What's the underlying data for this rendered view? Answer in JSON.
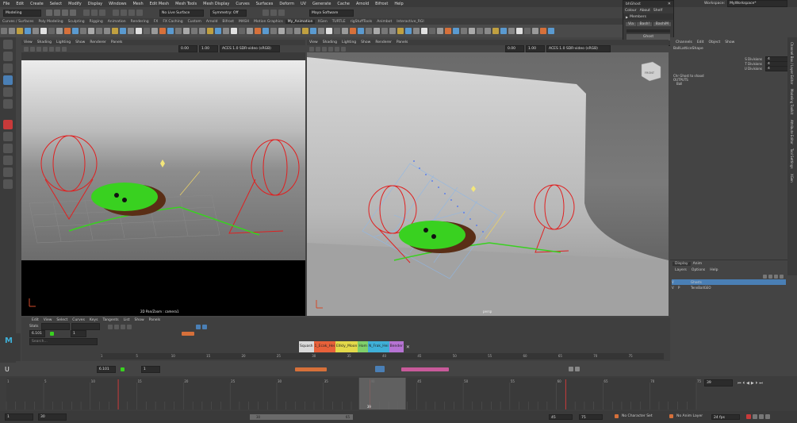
{
  "menubar": {
    "items": [
      "File",
      "Edit",
      "Create",
      "Select",
      "Modify",
      "Display",
      "Windows",
      "Mesh",
      "Edit Mesh",
      "Mesh Tools",
      "Mesh Display",
      "Curves",
      "Surfaces",
      "Deform",
      "UV",
      "Generate",
      "Cache",
      "Arnold",
      "Bifrost",
      "Help"
    ],
    "workspace_label": "Workspace:",
    "workspace_value": "MyWorkspace*"
  },
  "statusline": {
    "mode": "Modeling",
    "live_surface": "No Live Surface",
    "symmetry": "Symmetry: Off",
    "renderer": "Maya Software"
  },
  "shelf": {
    "tabs": [
      "Curves / Surfaces",
      "Poly Modeling",
      "Sculpting",
      "Rigging",
      "Animation",
      "Rendering",
      "FX",
      "FX Caching",
      "Custom",
      "Arnold",
      "Bifrost",
      "MASH",
      "Motion Graphics",
      "My_Animation",
      "XGen",
      "TURTLE",
      "rigStuffTools",
      "Animbot",
      "Interactive_RGI"
    ],
    "active": "My_Animation"
  },
  "popup": {
    "title": "bhGhost",
    "menu": [
      "Colour",
      "About",
      "Shelf"
    ],
    "section": "Members",
    "buttons": [
      "Via",
      "Bash!",
      "BashiM"
    ],
    "ghost_label": "Ghost"
  },
  "viewport_left": {
    "menu": [
      "View",
      "Shading",
      "Lighting",
      "Show",
      "Renderer",
      "Panels"
    ],
    "near": "0.00",
    "far": "1.00",
    "colorspace": "ACES 1.0 SDR-video (sRGB)",
    "camera_label": "2D Pan/Zoom : camera1"
  },
  "viewport_right": {
    "menu": [
      "View",
      "Shading",
      "Lighting",
      "Show",
      "Renderer",
      "Panels"
    ],
    "near": "0.00",
    "far": "1.00",
    "colorspace": "ACES 1.0 SDR-video (sRGB)",
    "camera_label": "persp",
    "viewcube_label": "FRONT"
  },
  "channelbox": {
    "tabs": [
      "Channels",
      "Edit",
      "Object",
      "Show"
    ],
    "object_name": "BallLatticeShape",
    "attributes": [
      {
        "name": "S Divisions",
        "value": "4"
      },
      {
        "name": "T Divisions",
        "value": "4"
      },
      {
        "name": "U Divisions",
        "value": "4"
      }
    ],
    "shapes_label": "Chr Ghost to shaod",
    "outputs_label": "OUTPUTS",
    "output_item": "Ball",
    "side_tabs": [
      "Channel Box / Layer Editor",
      "Modeling Toolkit",
      "Attribute Editor",
      "Tool Settings",
      "XGen"
    ]
  },
  "layers": {
    "tabs": [
      "Display",
      "Anim"
    ],
    "menu": [
      "Layers",
      "Options",
      "Help"
    ],
    "items": [
      {
        "v": "V",
        "p": "",
        "name": "Ghosts",
        "selected": true
      },
      {
        "v": "V",
        "p": "P",
        "name": "TennBallGEO",
        "selected": false
      }
    ]
  },
  "grapheditor": {
    "menu": [
      "Edit",
      "View",
      "Select",
      "Curves",
      "Keys",
      "Tangents",
      "List",
      "Show",
      "Panels"
    ],
    "stats_label": "Stats",
    "value1": "6.101",
    "value2": "1",
    "search_placeholder": "Search...",
    "ruler": [
      "1",
      "5",
      "10",
      "15",
      "20",
      "25",
      "30",
      "35",
      "40",
      "45",
      "50",
      "55",
      "60",
      "65",
      "70",
      "75"
    ]
  },
  "chips": [
    {
      "label": "Squash",
      "color": "#d9d9d9"
    },
    {
      "label": "1_Ecak_Hei",
      "color": "#e8613a"
    },
    {
      "label": "Ellkly_Moon",
      "color": "#e3d84a"
    },
    {
      "label": "Hom",
      "color": "#7fcf6a"
    },
    {
      "label": "N_Frak_Hei",
      "color": "#3fb0d8"
    },
    {
      "label": "Bender",
      "color": "#b673d3"
    }
  ],
  "anim_toolbar": {
    "value1": "6.101",
    "value2": "1"
  },
  "timeslider": {
    "ticks": [
      "1",
      "5",
      "10",
      "15",
      "20",
      "25",
      "30",
      "35",
      "40",
      "45",
      "50",
      "55",
      "60",
      "65",
      "70",
      "75"
    ],
    "current_frame": "39",
    "current_field": "39"
  },
  "rangebar": {
    "start": "1",
    "start_inner": "30",
    "range_start_label": "30",
    "range_end_label": "65",
    "end_inner": "45",
    "end": "75",
    "character": "No Character Set",
    "anim_layer": "No Anim Layer",
    "fps": "24 fps"
  },
  "colors": {
    "accent_blue": "#4a7fb5",
    "key_red": "#c83a3a",
    "ball_green": "#39d120",
    "rig_red": "#e02020"
  },
  "icons": [
    "select-icon",
    "lasso-icon",
    "paint-icon",
    "move-icon",
    "rotate-icon",
    "scale-icon",
    "search-icon",
    "gear-icon",
    "play-icon",
    "key-icon"
  ]
}
